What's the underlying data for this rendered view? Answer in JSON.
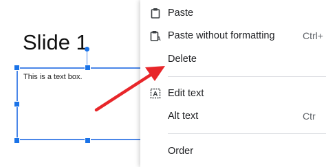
{
  "slide": {
    "title": "Slide 1",
    "textbox_text": "This is a text box."
  },
  "context_menu": {
    "items": [
      {
        "label": "Paste",
        "icon": "clipboard-icon",
        "shortcut": ""
      },
      {
        "label": "Paste without formatting",
        "icon": "clipboard-text-icon",
        "shortcut": "Ctrl+"
      },
      {
        "label": "Delete",
        "icon": "",
        "shortcut": ""
      },
      {
        "label": "Edit text",
        "icon": "edit-text-icon",
        "shortcut": ""
      },
      {
        "label": "Alt text",
        "icon": "",
        "shortcut": "Ctr"
      },
      {
        "label": "Order",
        "icon": "",
        "shortcut": ""
      }
    ]
  },
  "colors": {
    "selection": "#4a86e8",
    "arrow": "#e8262a",
    "menu_text": "#202124",
    "divider": "#dadce0"
  }
}
